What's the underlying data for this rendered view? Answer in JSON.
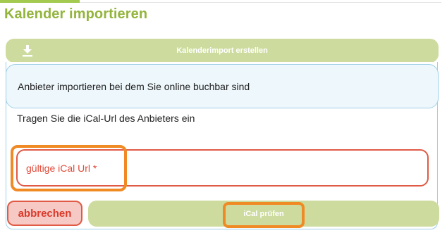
{
  "header": {
    "title": "Kalender importieren"
  },
  "import_bar": {
    "icon": "download-icon",
    "label": "Kalenderimport erstellen"
  },
  "panel": {
    "info_text": "Anbieter importieren bei dem Sie online buchbar sind",
    "instruction": "Tragen Sie die iCal-Url des Anbieters ein",
    "url_field": {
      "value": "",
      "placeholder": "gültige iCal Url *"
    },
    "cancel_label": "abbrechen",
    "check_label": "iCal prüfen"
  },
  "colors": {
    "brand_green": "#93b43d",
    "button_green": "#cddc9e",
    "error_red": "#e05a45",
    "info_blue": "#9ed0e8",
    "highlight_orange": "#f08a24"
  }
}
